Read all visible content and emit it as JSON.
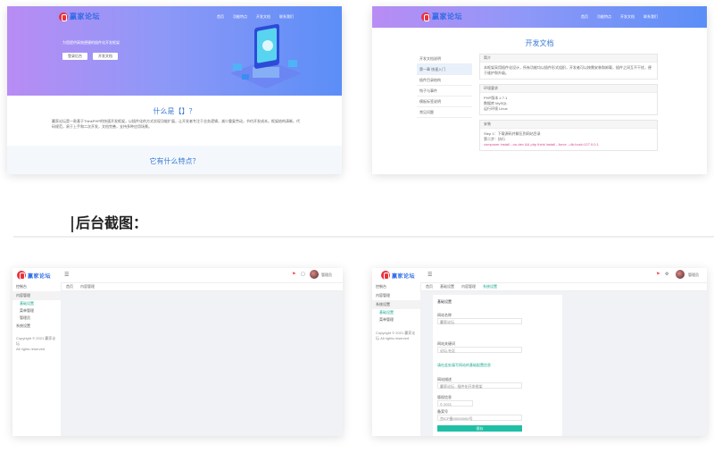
{
  "site": {
    "logo_text": "赢家论坛",
    "nav": [
      "首页",
      "功能特点",
      "开发文档",
      "联系我们"
    ]
  },
  "card1": {
    "hero_sub": "为您提供高效便捷的插件化开发框架",
    "btn_login": "登录后台",
    "btn_doc": "开发文档",
    "section1_title": "什么是【】？",
    "section1_text": "赢家论坛是一款基于ThinkPHP的快速开发框架，以插件化的方式实现功能扩展，让开发者专注于业务逻辑，减少重复劳动，节约开发成本。框架结构清晰，代码规范，易于上手和二次开发，文档完善，支持多种应用场景。",
    "section2_title": "它有什么特点？"
  },
  "card2": {
    "doc_title": "开发文档",
    "left_menu": [
      "开发文档说明",
      "第一章 快速入门",
      "插件目录结构",
      "钩子与事件",
      "模板标签说明",
      "常见问题"
    ],
    "box1_head": "简介",
    "box1_text": "本框架采用插件化设计，所有功能均以插件形式组织，开发者可以按需安装和卸载，插件之间互不干扰，便于维护和升级。",
    "box2_head": "环境要求",
    "box2_lines": [
      "PHP版本 ≥ 7.1",
      "数据库 MySQL",
      "运行环境 Linux"
    ],
    "box3_head": "安装",
    "box3_lines": [
      "Step 1：下载源码并解压到网站目录",
      "第二步：执行"
    ],
    "box3_pink": "composer install --no-dev && php think install --force --db-host=127.0.0.1"
  },
  "section_heading": "后台截图：",
  "admin1": {
    "logo_text": "赢家论坛",
    "menu": [
      "控制台",
      "内容管理",
      "系统设置"
    ],
    "submenu": [
      "基础设置",
      "菜单管理",
      "管理员"
    ],
    "breadcrumb": [
      "首页",
      "内容管理"
    ],
    "footer": [
      "Copyright © 2021 赢家论坛",
      "All rights reserved"
    ],
    "user": "管理员"
  },
  "admin2": {
    "logo_text": "赢家论坛",
    "menu": [
      "控制台",
      "内容管理",
      "系统设置"
    ],
    "submenu": [
      "基础设置",
      "菜单管理"
    ],
    "tabs": [
      "首页",
      "基础设置",
      "内容管理",
      "系统设置"
    ],
    "footer": "Copyright © 2021 赢家论坛 All rights reserved",
    "form_title": "基础设置",
    "fields": [
      {
        "label": "网站名称",
        "value": "赢家论坛"
      },
      {
        "label": "网站关键词",
        "value": "论坛,社区"
      },
      {
        "label": "网站描述",
        "value": "赢家论坛 - 插件化开发框架"
      },
      {
        "label": "版权信息",
        "value": "© 2021"
      },
      {
        "label": "备案号",
        "value": "京ICP备00000000号"
      }
    ],
    "hint": "请在此处填写网站的基础配置信息",
    "submit": "保存",
    "user": "管理员"
  },
  "colors": {
    "hero_start": "#b88cf4",
    "hero_end": "#5b8ef7",
    "accent": "#1fbfa5",
    "logo_red": "#e8333f"
  }
}
